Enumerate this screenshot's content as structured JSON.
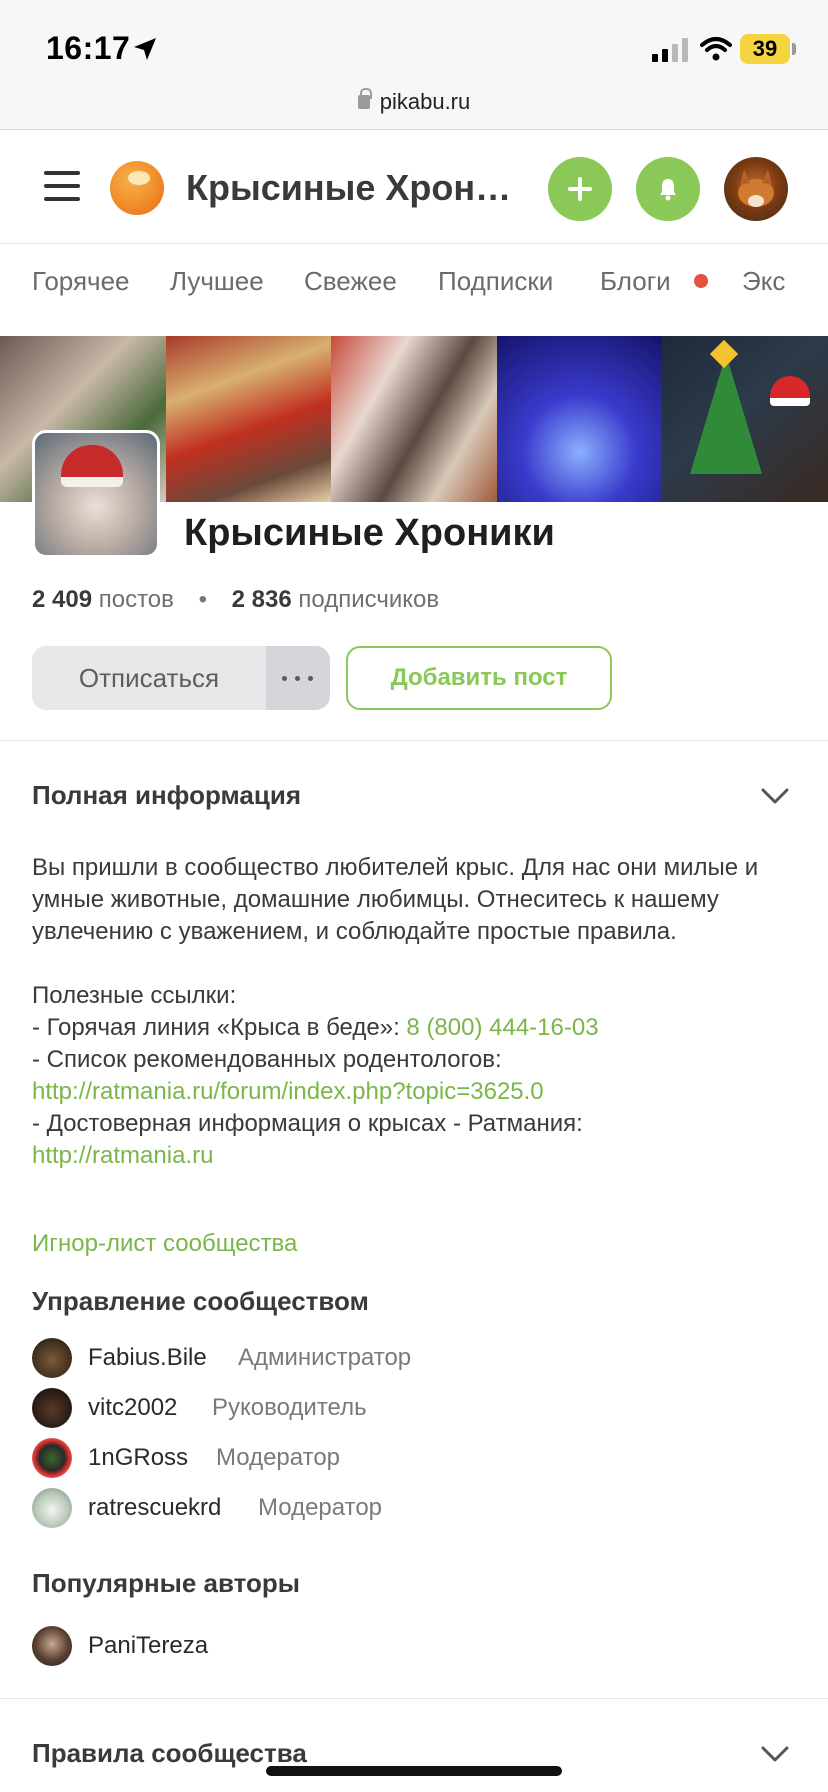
{
  "status_bar": {
    "time": "16:17",
    "battery": "39",
    "icons": [
      "location-arrow-icon",
      "signal-icon",
      "wifi-icon",
      "battery-icon"
    ]
  },
  "browser": {
    "url": "pikabu.ru"
  },
  "header": {
    "title": "Крысиные Хрон…",
    "icons": [
      "menu-icon",
      "plus-icon",
      "bell-icon"
    ]
  },
  "tabs": [
    {
      "label": "Горячее"
    },
    {
      "label": "Лучшее"
    },
    {
      "label": "Свежее"
    },
    {
      "label": "Подписки"
    },
    {
      "label": "Блоги"
    },
    {
      "label": "Экс"
    }
  ],
  "community": {
    "title": "Крысиные Хроники",
    "posts_count": "2 409",
    "posts_label": "постов",
    "subscribers_count": "2 836",
    "subscribers_label": "подписчиков",
    "separator": "•",
    "unsubscribe_label": "Отписаться",
    "add_post_label": "Добавить пост"
  },
  "info": {
    "title": "Полная информация",
    "desc_1": "Вы пришли в сообщество любителей крыс. Для нас они милые и умные животные, домашние любимцы. Отнеситесь к нашему увлечению с уважением, и соблюдайте  простые правила.",
    "useful_links": "Полезные ссылки:",
    "hotline_prefix": "- Горячая линия «Крыса в беде»: ",
    "hotline_phone": "8 (800) 444-16-03",
    "rodentologists": "- Список рекомендованных родентологов:",
    "rodentologists_url": "http://ratmania.ru/forum/index.php?topic=3625.0",
    "reliable_info": "- Достоверная информация о крысах - Ратмания:",
    "reliable_url": "http://ratmania.ru",
    "ignore_list": "Игнор-лист сообщества"
  },
  "management": {
    "title": "Управление сообществом",
    "members": [
      {
        "name": "Fabius.Bile",
        "role": "Администратор"
      },
      {
        "name": "vitc2002",
        "role": "Руководитель"
      },
      {
        "name": "1nGRoss",
        "role": "Модератор"
      },
      {
        "name": "ratrescuekrd",
        "role": "Модератор"
      }
    ]
  },
  "popular": {
    "title": "Популярные авторы",
    "authors": [
      {
        "name": "PaniTereza"
      }
    ]
  },
  "rules": {
    "title": "Правила сообщества"
  }
}
